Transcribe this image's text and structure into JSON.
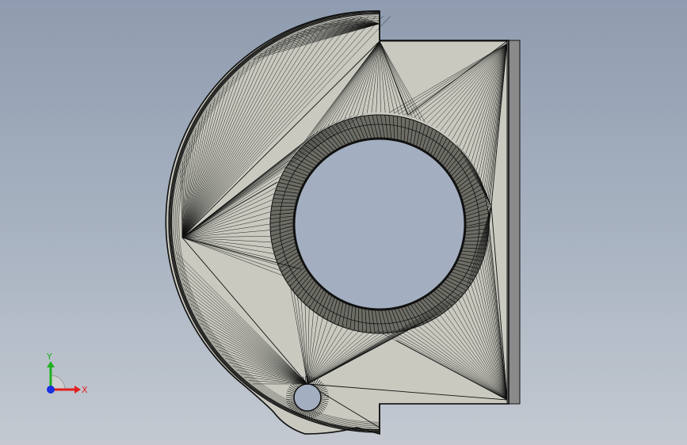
{
  "viewport": {
    "background_top": "#8f9caf",
    "background_bottom": "#c4c9d1"
  },
  "model": {
    "face_color": "#c9c9c0",
    "edge_color": "#111111",
    "side_face_color": "#8a8a8a",
    "hole_color": "#a3afc0"
  },
  "triad": {
    "x_label": "X",
    "y_label": "Y",
    "x_color": "#e02020",
    "y_color": "#20b020",
    "z_color": "#1830e0"
  }
}
